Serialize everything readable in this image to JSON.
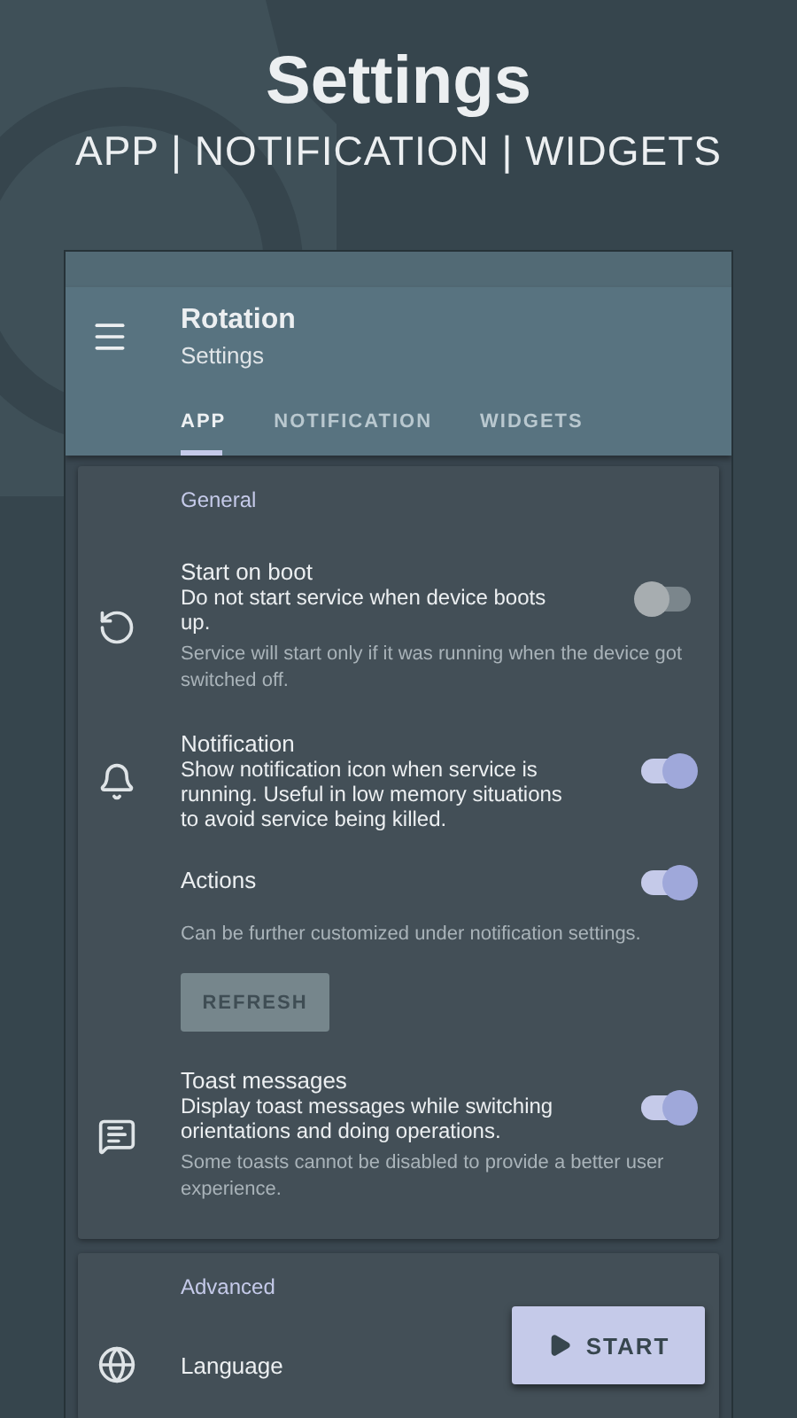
{
  "header": {
    "title": "Settings",
    "subtitle": "APP | NOTIFICATION | WIDGETS"
  },
  "app_bar": {
    "title": "Rotation",
    "subtitle": "Settings"
  },
  "tabs": [
    {
      "label": "APP",
      "selected": true
    },
    {
      "label": "NOTIFICATION",
      "selected": false
    },
    {
      "label": "WIDGETS",
      "selected": false
    }
  ],
  "sections": [
    {
      "title": "General",
      "items": [
        {
          "kind": "switch",
          "title": "Start on boot",
          "summary": "Do not start service when device boots up.",
          "note": "Service will start only if it was running when the device got switched off.",
          "on": false
        },
        {
          "kind": "switch",
          "title": "Notification",
          "summary": "Show notification icon when service is running. Useful in low memory situations to avoid service being killed.",
          "on": true
        },
        {
          "kind": "switch",
          "title": "Actions",
          "note": "Can be further customized under notification settings.",
          "button": "REFRESH",
          "on": true
        },
        {
          "kind": "switch",
          "title": "Toast messages",
          "summary": "Display toast messages while switching orientations and doing operations.",
          "note": "Some toasts cannot be disabled to provide a better user experience.",
          "on": true
        }
      ]
    },
    {
      "title": "Advanced",
      "items": [
        {
          "kind": "link",
          "title": "Language"
        }
      ]
    }
  ],
  "fab": {
    "label": "START"
  }
}
